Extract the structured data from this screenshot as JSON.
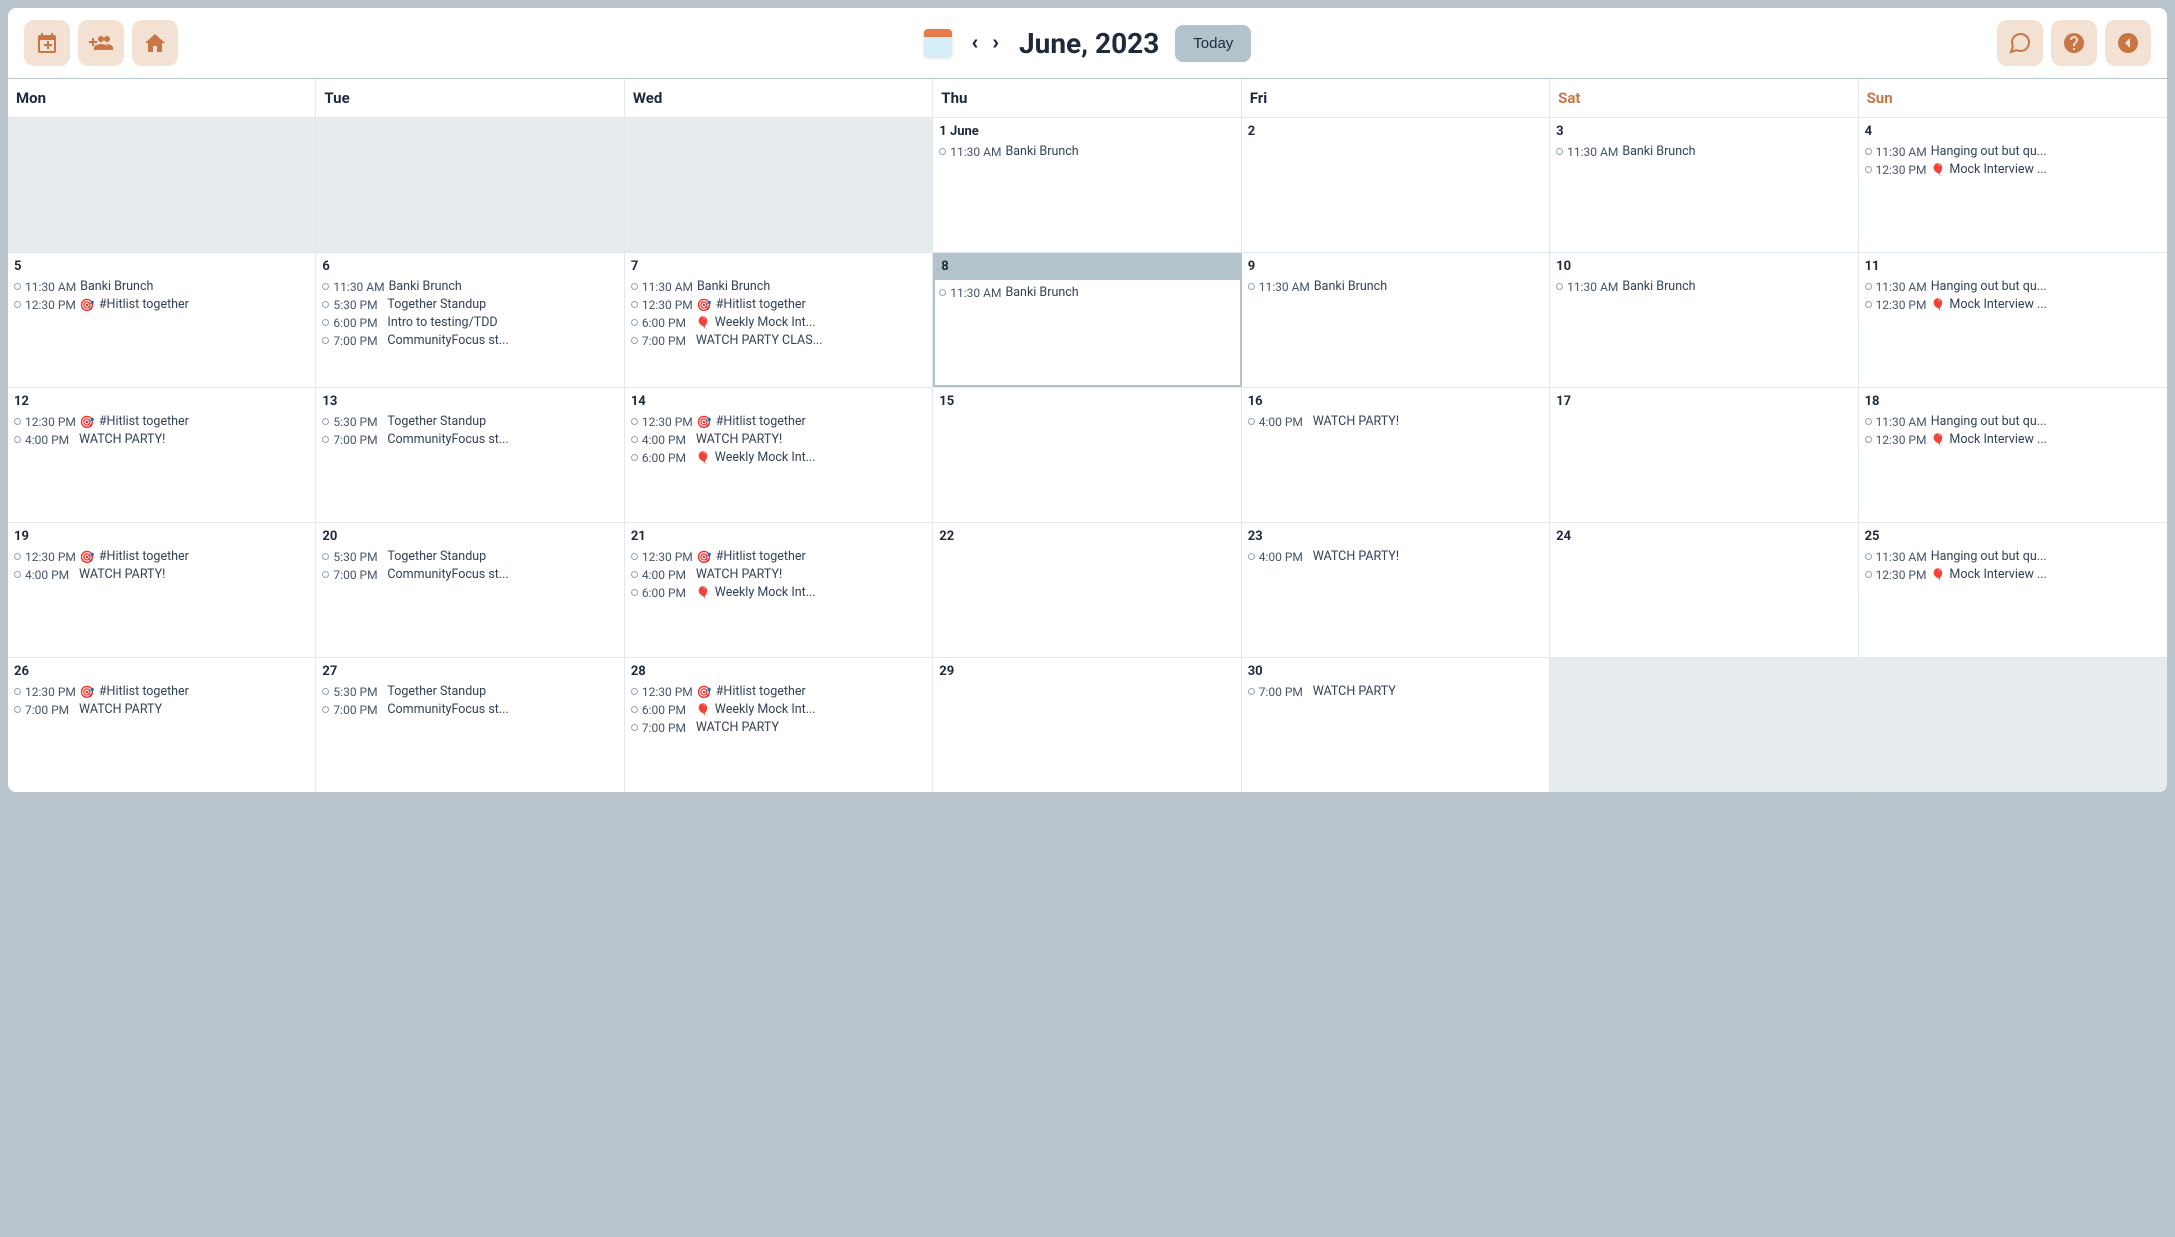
{
  "header": {
    "month_title": "June, 2023",
    "today_label": "Today"
  },
  "day_names": [
    "Mon",
    "Tue",
    "Wed",
    "Thu",
    "Fri",
    "Sat",
    "Sun"
  ],
  "weekend_indices": [
    5,
    6
  ],
  "today_date": "8",
  "weeks": [
    [
      {
        "blank": true
      },
      {
        "blank": true
      },
      {
        "blank": true
      },
      {
        "label": "1 June",
        "events": [
          {
            "time": "11:30 AM",
            "title": "Banki Brunch"
          }
        ]
      },
      {
        "label": "2",
        "events": []
      },
      {
        "label": "3",
        "events": [
          {
            "time": "11:30 AM",
            "title": "Banki Brunch"
          }
        ]
      },
      {
        "label": "4",
        "events": [
          {
            "time": "11:30 AM",
            "title": "Hanging out but qu..."
          },
          {
            "time": "12:30 PM",
            "icon": "🎈",
            "title": "Mock Interview ..."
          }
        ]
      }
    ],
    [
      {
        "label": "5",
        "events": [
          {
            "time": "11:30 AM",
            "title": "Banki Brunch"
          },
          {
            "time": "12:30 PM",
            "icon": "🎯",
            "title": "#Hitlist together"
          }
        ]
      },
      {
        "label": "6",
        "events": [
          {
            "time": "11:30 AM",
            "title": "Banki Brunch"
          },
          {
            "time": "5:30 PM",
            "title": "Together Standup"
          },
          {
            "time": "6:00 PM",
            "title": "Intro to testing/TDD"
          },
          {
            "time": "7:00 PM",
            "title": "CommunityFocus st..."
          }
        ]
      },
      {
        "label": "7",
        "events": [
          {
            "time": "11:30 AM",
            "title": "Banki Brunch"
          },
          {
            "time": "12:30 PM",
            "icon": "🎯",
            "title": "#Hitlist together"
          },
          {
            "time": "6:00 PM",
            "icon": "🎈",
            "title": "Weekly Mock Int..."
          },
          {
            "time": "7:00 PM",
            "title": "WATCH PARTY CLAS..."
          }
        ]
      },
      {
        "label": "8",
        "today": true,
        "events": [
          {
            "time": "11:30 AM",
            "title": "Banki Brunch"
          }
        ]
      },
      {
        "label": "9",
        "events": [
          {
            "time": "11:30 AM",
            "title": "Banki Brunch"
          }
        ]
      },
      {
        "label": "10",
        "events": [
          {
            "time": "11:30 AM",
            "title": "Banki Brunch"
          }
        ]
      },
      {
        "label": "11",
        "events": [
          {
            "time": "11:30 AM",
            "title": "Hanging out but qu..."
          },
          {
            "time": "12:30 PM",
            "icon": "🎈",
            "title": "Mock Interview ..."
          }
        ]
      }
    ],
    [
      {
        "label": "12",
        "events": [
          {
            "time": "12:30 PM",
            "icon": "🎯",
            "title": "#Hitlist together"
          },
          {
            "time": "4:00 PM",
            "title": "WATCH PARTY!"
          }
        ]
      },
      {
        "label": "13",
        "events": [
          {
            "time": "5:30 PM",
            "title": "Together Standup"
          },
          {
            "time": "7:00 PM",
            "title": "CommunityFocus st..."
          }
        ]
      },
      {
        "label": "14",
        "events": [
          {
            "time": "12:30 PM",
            "icon": "🎯",
            "title": "#Hitlist together"
          },
          {
            "time": "4:00 PM",
            "title": "WATCH PARTY!"
          },
          {
            "time": "6:00 PM",
            "icon": "🎈",
            "title": "Weekly Mock Int..."
          }
        ]
      },
      {
        "label": "15",
        "events": []
      },
      {
        "label": "16",
        "events": [
          {
            "time": "4:00 PM",
            "title": "WATCH PARTY!"
          }
        ]
      },
      {
        "label": "17",
        "events": []
      },
      {
        "label": "18",
        "events": [
          {
            "time": "11:30 AM",
            "title": "Hanging out but qu..."
          },
          {
            "time": "12:30 PM",
            "icon": "🎈",
            "title": "Mock Interview ..."
          }
        ]
      }
    ],
    [
      {
        "label": "19",
        "events": [
          {
            "time": "12:30 PM",
            "icon": "🎯",
            "title": "#Hitlist together"
          },
          {
            "time": "4:00 PM",
            "title": "WATCH PARTY!"
          }
        ]
      },
      {
        "label": "20",
        "events": [
          {
            "time": "5:30 PM",
            "title": "Together Standup"
          },
          {
            "time": "7:00 PM",
            "title": "CommunityFocus st..."
          }
        ]
      },
      {
        "label": "21",
        "events": [
          {
            "time": "12:30 PM",
            "icon": "🎯",
            "title": "#Hitlist together"
          },
          {
            "time": "4:00 PM",
            "title": "WATCH PARTY!"
          },
          {
            "time": "6:00 PM",
            "icon": "🎈",
            "title": "Weekly Mock Int..."
          }
        ]
      },
      {
        "label": "22",
        "events": []
      },
      {
        "label": "23",
        "events": [
          {
            "time": "4:00 PM",
            "title": "WATCH PARTY!"
          }
        ]
      },
      {
        "label": "24",
        "events": []
      },
      {
        "label": "25",
        "events": [
          {
            "time": "11:30 AM",
            "title": "Hanging out but qu..."
          },
          {
            "time": "12:30 PM",
            "icon": "🎈",
            "title": "Mock Interview ..."
          }
        ]
      }
    ],
    [
      {
        "label": "26",
        "events": [
          {
            "time": "12:30 PM",
            "icon": "🎯",
            "title": "#Hitlist together"
          },
          {
            "time": "7:00 PM",
            "title": "WATCH PARTY"
          }
        ]
      },
      {
        "label": "27",
        "events": [
          {
            "time": "5:30 PM",
            "title": "Together Standup"
          },
          {
            "time": "7:00 PM",
            "title": "CommunityFocus st..."
          }
        ]
      },
      {
        "label": "28",
        "events": [
          {
            "time": "12:30 PM",
            "icon": "🎯",
            "title": "#Hitlist together"
          },
          {
            "time": "6:00 PM",
            "icon": "🎈",
            "title": "Weekly Mock Int..."
          },
          {
            "time": "7:00 PM",
            "title": "WATCH PARTY"
          }
        ]
      },
      {
        "label": "29",
        "events": []
      },
      {
        "label": "30",
        "events": [
          {
            "time": "7:00 PM",
            "title": "WATCH PARTY"
          }
        ]
      },
      {
        "blank": true
      },
      {
        "blank": true
      }
    ]
  ]
}
